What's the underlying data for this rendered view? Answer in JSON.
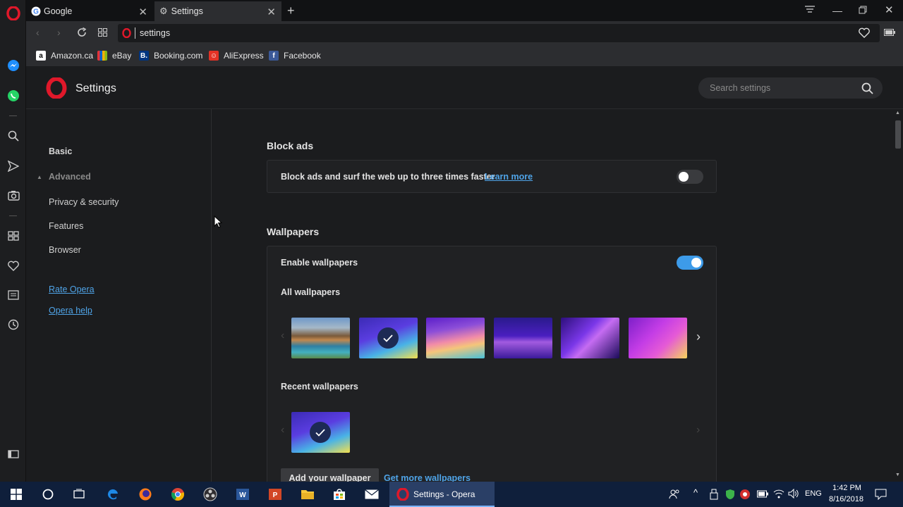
{
  "tabs": [
    {
      "title": "Google",
      "icon": "google-icon"
    },
    {
      "title": "Settings",
      "icon": "gear-icon"
    }
  ],
  "address": {
    "url": "settings"
  },
  "bookmarks": [
    {
      "label": "Amazon.ca",
      "letter": "a",
      "color": "#ffffff"
    },
    {
      "label": "eBay",
      "letter": "e",
      "color": "#e53238"
    },
    {
      "label": "Booking.com",
      "letter": "B.",
      "color": "#003580"
    },
    {
      "label": "AliExpress",
      "letter": "",
      "color": "#e43225"
    },
    {
      "label": "Facebook",
      "letter": "f",
      "color": "#3b5998"
    }
  ],
  "header": {
    "title": "Settings",
    "search_placeholder": "Search settings"
  },
  "nav": {
    "basic": "Basic",
    "advanced": "Advanced",
    "privacy": "Privacy & security",
    "features": "Features",
    "browser": "Browser",
    "rate": "Rate Opera",
    "help": "Opera help"
  },
  "block_ads": {
    "title": "Block ads",
    "description": "Block ads and surf the web up to three times faster",
    "learn_more": "Learn more",
    "enabled": false
  },
  "wallpapers": {
    "title": "Wallpapers",
    "enable_label": "Enable wallpapers",
    "enabled": true,
    "all_label": "All wallpapers",
    "recent_label": "Recent wallpapers",
    "add_button": "Add your wallpaper",
    "get_more": "Get more wallpapers",
    "selected_index": 1
  },
  "taskbar": {
    "active_app": "Settings - Opera",
    "language": "ENG",
    "time": "1:42 PM",
    "date": "8/16/2018"
  },
  "colors": {
    "accent": "#3d9be9",
    "opera_red": "#e0182a",
    "link": "#4fa4e8"
  }
}
